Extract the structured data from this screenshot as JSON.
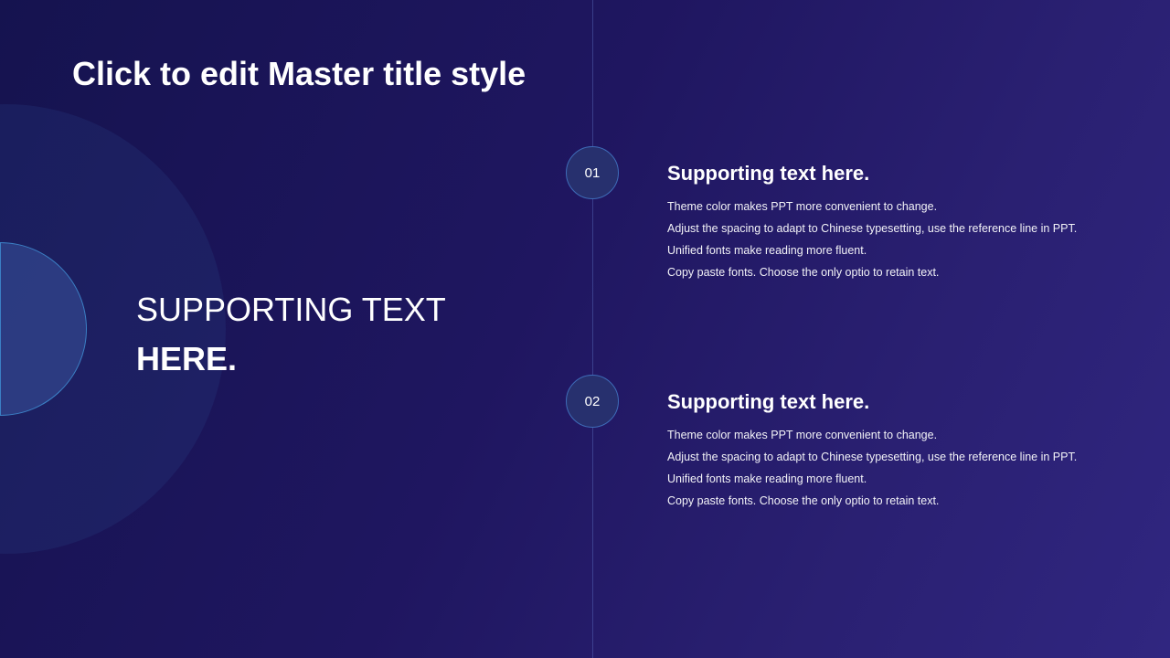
{
  "slide": {
    "title": "Click to edit Master title style",
    "left_text": {
      "line1": "SUPPORTING TEXT",
      "line2": "HERE."
    },
    "items": [
      {
        "number": "01",
        "heading": "Supporting text here.",
        "lines": [
          "Theme color makes PPT more convenient to change.",
          "Adjust the spacing to adapt to Chinese typesetting, use the reference line in PPT.",
          "Unified fonts make reading more fluent.",
          "Copy paste fonts. Choose the only optio to retain text."
        ]
      },
      {
        "number": "02",
        "heading": "Supporting text here.",
        "lines": [
          "Theme color makes PPT more convenient to change.",
          "Adjust the spacing to adapt to Chinese typesetting, use the reference line in PPT.",
          "Unified fonts make reading more fluent.",
          "Copy paste fonts. Choose the only optio to retain text."
        ]
      }
    ]
  },
  "colors": {
    "background_start": "#15134f",
    "background_end": "#302680",
    "accent_outline": "#3b7fc4",
    "number_circle_fill": "#27306e"
  }
}
